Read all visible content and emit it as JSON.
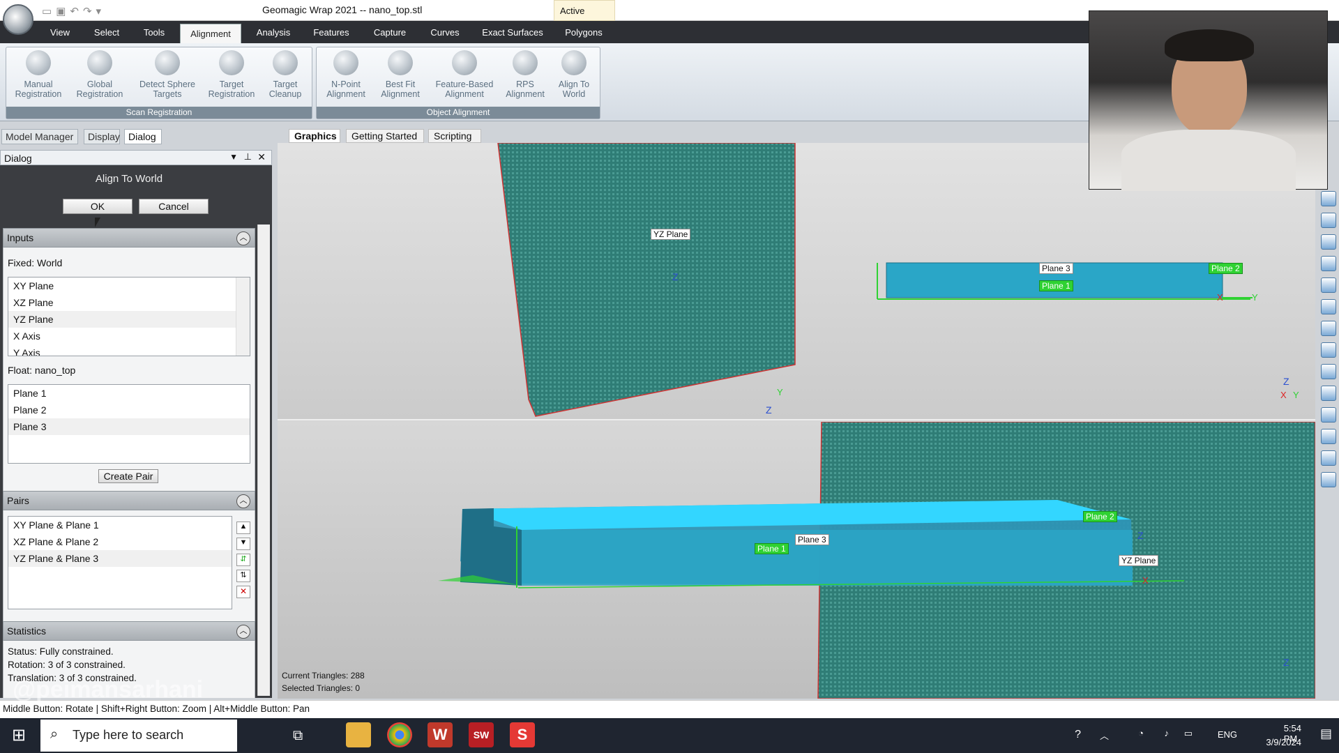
{
  "window": {
    "title": "Geomagic Wrap 2021 -- nano_top.stl",
    "active_tab": "Active"
  },
  "menubar": {
    "items": [
      "View",
      "Select",
      "Tools",
      "Alignment",
      "Analysis",
      "Features",
      "Capture",
      "Curves",
      "Exact Surfaces",
      "Polygons"
    ],
    "active": "Alignment"
  },
  "ribbon": {
    "groups": [
      {
        "label": "Scan Registration",
        "buttons": [
          "Manual\nRegistration",
          "Global\nRegistration",
          "Detect Sphere\nTargets",
          "Target\nRegistration",
          "Target\nCleanup"
        ]
      },
      {
        "label": "Object Alignment",
        "buttons": [
          "N-Point\nAlignment",
          "Best Fit\nAlignment",
          "Feature-Based\nAlignment",
          "RPS\nAlignment",
          "Align To\nWorld"
        ]
      }
    ]
  },
  "panel_tabs": [
    "Model Manager",
    "Display",
    "Dialog"
  ],
  "dialog": {
    "header": "Dialog",
    "title": "Align To World",
    "ok": "OK",
    "cancel": "Cancel",
    "inputs": {
      "label": "Inputs",
      "fixed_label": "Fixed: World",
      "fixed_items": [
        "XY Plane",
        "XZ Plane",
        "YZ Plane",
        "X Axis",
        "Y Axis"
      ],
      "float_label": "Float: nano_top",
      "float_items": [
        "Plane 1",
        "Plane 2",
        "Plane 3"
      ],
      "create_pair": "Create Pair"
    },
    "pairs": {
      "label": "Pairs",
      "items": [
        "XY Plane & Plane 1",
        "XZ Plane & Plane 2",
        "YZ Plane & Plane 3"
      ]
    },
    "statistics": {
      "label": "Statistics",
      "lines": [
        "Status: Fully constrained.",
        "Rotation: 3 of 3 constrained.",
        "Translation: 3 of 3 constrained."
      ]
    }
  },
  "viewport": {
    "tabs": [
      "Graphics",
      "Getting Started",
      "Scripting"
    ],
    "labels": {
      "yz_top": "YZ Plane",
      "plane3_top": "Plane 3",
      "plane1_top": "Plane 1",
      "plane2_top": "Plane 2",
      "plane1_bottom": "Plane 1",
      "plane3_bottom": "Plane 3",
      "plane2_bottom": "Plane 2",
      "yz_bottom": "YZ Plane"
    },
    "status_triangles": "Current Triangles: 288",
    "status_selected": "Selected Triangles: 0"
  },
  "statusbar": "Middle Button: Rotate | Shift+Right Button: Zoom | Alt+Middle Button: Pan",
  "taskbar": {
    "search_placeholder": "Type here to search",
    "language": "ENG",
    "time": "5:54 PM",
    "date": "3/9/2024"
  },
  "watermark": "@peimansarhani",
  "colors": {
    "part_top": "#33d6ff",
    "part_side": "#2e95b5",
    "plane_green": "#2fd233",
    "menubar": "#2d2f34"
  }
}
